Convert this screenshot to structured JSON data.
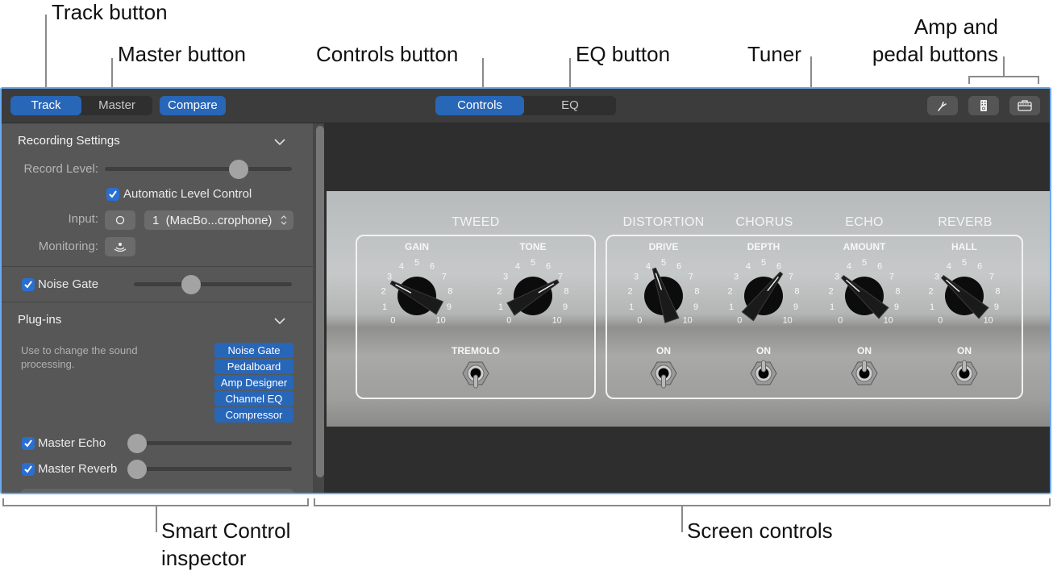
{
  "callouts": {
    "track_button": "Track button",
    "master_button": "Master button",
    "controls_button": "Controls button",
    "eq_button": "EQ button",
    "tuner": "Tuner",
    "amp_pedal_line1": "Amp and",
    "amp_pedal_line2": "pedal buttons",
    "smart_control_line1": "Smart Control",
    "smart_control_line2": "inspector",
    "screen_controls": "Screen controls"
  },
  "toolbar": {
    "track_label": "Track",
    "master_label": "Master",
    "compare_label": "Compare",
    "controls_label": "Controls",
    "eq_label": "EQ",
    "active_scope": "Track",
    "active_view": "Controls",
    "icons": [
      "tuning-fork-icon",
      "pedalboard-icon",
      "amp-icon"
    ]
  },
  "inspector": {
    "recording_settings": {
      "title": "Recording Settings",
      "record_level_label": "Record Level:",
      "record_level_value": 0.73,
      "auto_level_label": "Automatic Level Control",
      "auto_level_checked": true,
      "input_label": "Input:",
      "input_value": "1  (MacBo...crophone)",
      "monitoring_label": "Monitoring:"
    },
    "noise_gate": {
      "label": "Noise Gate",
      "checked": true,
      "value": 0.36
    },
    "plugins": {
      "title": "Plug-ins",
      "description": "Use to change the sound processing.",
      "items": [
        "Noise Gate",
        "Pedalboard",
        "Amp Designer",
        "Channel EQ",
        "Compressor"
      ]
    },
    "master_echo": {
      "label": "Master Echo",
      "checked": true,
      "value": 0.0
    },
    "master_reverb": {
      "label": "Master Reverb",
      "checked": true,
      "value": 0.0
    }
  },
  "amp": {
    "sections": [
      {
        "title": "TWEED"
      },
      {
        "title": "DISTORTION"
      },
      {
        "title": "CHORUS"
      },
      {
        "title": "ECHO"
      },
      {
        "title": "REVERB"
      }
    ],
    "knobs": [
      {
        "label": "GAIN",
        "value": 2.7
      },
      {
        "label": "TONE",
        "value": 7.2
      },
      {
        "label": "DRIVE",
        "value": 4.3
      },
      {
        "label": "DEPTH",
        "value": 6.4
      },
      {
        "label": "AMOUNT",
        "value": 3.2
      },
      {
        "label": "HALL",
        "value": 3.2
      }
    ],
    "switches": [
      {
        "label": "TREMOLO",
        "on": false
      },
      {
        "label": "ON",
        "on": false
      },
      {
        "label": "ON",
        "on": true
      },
      {
        "label": "ON",
        "on": true
      },
      {
        "label": "ON",
        "on": true
      }
    ],
    "scale": [
      "0",
      "1",
      "2",
      "3",
      "4",
      "5",
      "6",
      "7",
      "8",
      "9",
      "10"
    ]
  }
}
